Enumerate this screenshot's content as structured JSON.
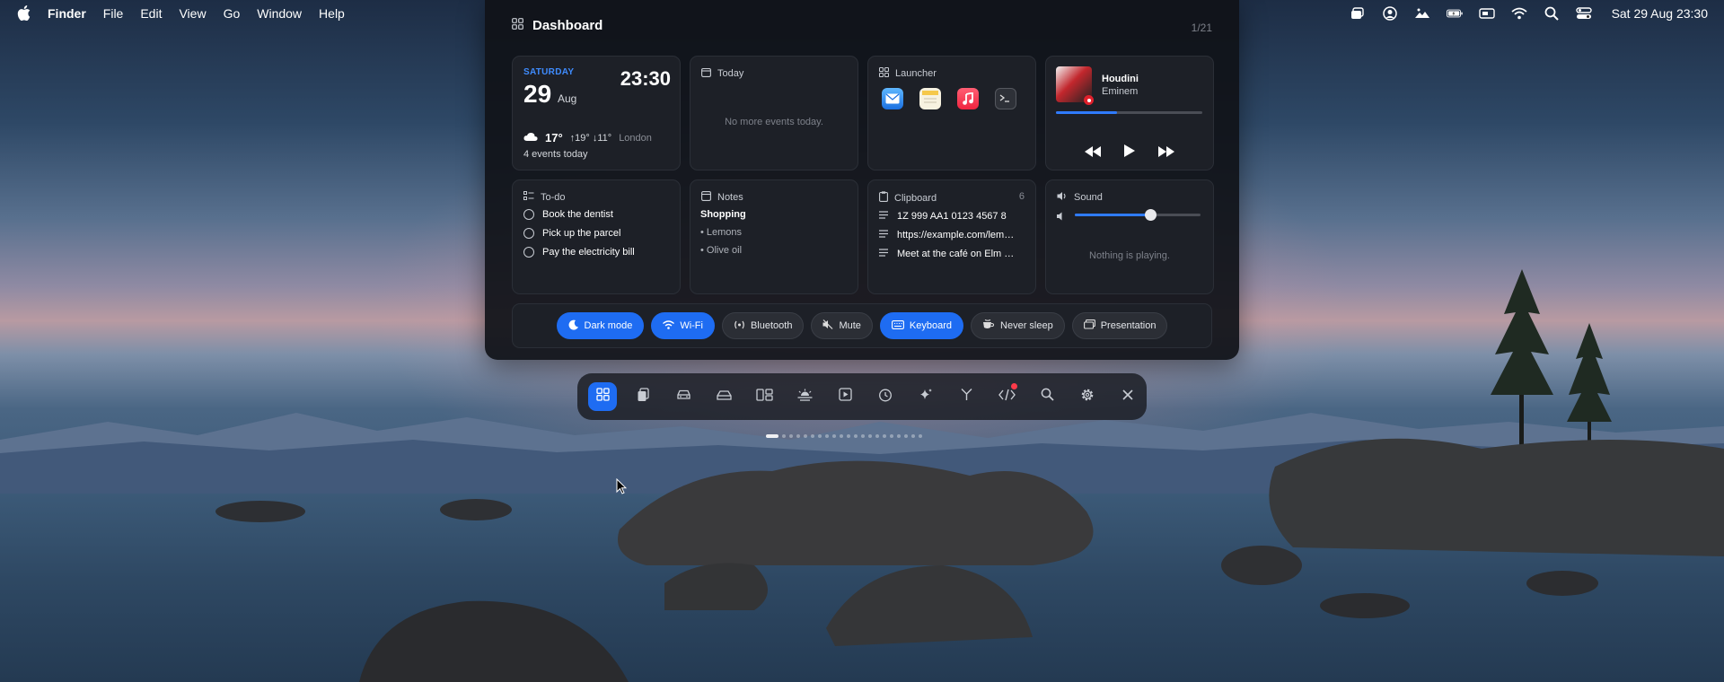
{
  "menubar": {
    "app_name": "Finder",
    "menus": [
      "File",
      "Edit",
      "View",
      "Go",
      "Window",
      "Help"
    ],
    "status_icons": [
      "stack-icon",
      "user-circle-icon",
      "scene-icon",
      "battery-charging-icon",
      "display-icon",
      "wifi-icon",
      "search-icon",
      "control-center-icon"
    ],
    "clock": "Sat 29 Aug  23:30"
  },
  "dashboard": {
    "title": "Dashboard",
    "page_count": "1/21",
    "date_widget": {
      "weekday": "SATURDAY",
      "day": "29",
      "month": "Aug",
      "time": "23:30",
      "temp": "17°",
      "high_low": "↑19° ↓11°",
      "location": "London",
      "events": "4 events today"
    },
    "today": {
      "title": "Today",
      "empty": "No more events today."
    },
    "launcher": {
      "title": "Launcher",
      "apps": [
        "mail-icon",
        "notes-icon",
        "music-icon",
        "terminal-icon"
      ]
    },
    "music": {
      "track": "Houdini",
      "artist": "Eminem",
      "progress": 0.42
    },
    "todo": {
      "title": "To-do",
      "items": [
        "Book the dentist",
        "Pick up the parcel",
        "Pay the electricity bill"
      ]
    },
    "notes": {
      "title": "Notes",
      "heading": "Shopping",
      "items": [
        "• Lemons",
        "• Olive oil"
      ]
    },
    "clipboard": {
      "title": "Clipboard",
      "count": "6",
      "items": [
        "1Z 999 AA1 0123 4567 8",
        "https://example.com/lemons",
        "Meet at the café on Elm Road"
      ]
    },
    "sound": {
      "title": "Sound",
      "volume": 0.6,
      "empty": "Nothing is playing."
    },
    "toggles": [
      {
        "label": "Dark mode",
        "on": true,
        "icon": "moon-icon"
      },
      {
        "label": "Wi-Fi",
        "on": true,
        "icon": "wifi-icon"
      },
      {
        "label": "Bluetooth",
        "on": false,
        "icon": "bluetooth-icon"
      },
      {
        "label": "Mute",
        "on": false,
        "icon": "mute-icon"
      },
      {
        "label": "Keyboard",
        "on": true,
        "icon": "keyboard-icon"
      },
      {
        "label": "Never sleep",
        "on": false,
        "icon": "coffee-icon"
      },
      {
        "label": "Presentation",
        "on": false,
        "icon": "presentation-icon"
      }
    ]
  },
  "dock": {
    "items": [
      "dashboard-icon",
      "clipboard-icon",
      "car-icon",
      "drive-icon",
      "layout-icon",
      "weather-icon",
      "media-icon",
      "timer-icon",
      "sparkle-icon",
      "branch-icon",
      "code-icon",
      "search-icon",
      "settings-icon",
      "close-icon"
    ],
    "active": 0,
    "badge_on": 10,
    "pages": 21,
    "current_page": 0
  },
  "colors": {
    "accent": "#1e6cf2",
    "date_accent": "#3f8cff",
    "badge": "#ff3b4a"
  }
}
